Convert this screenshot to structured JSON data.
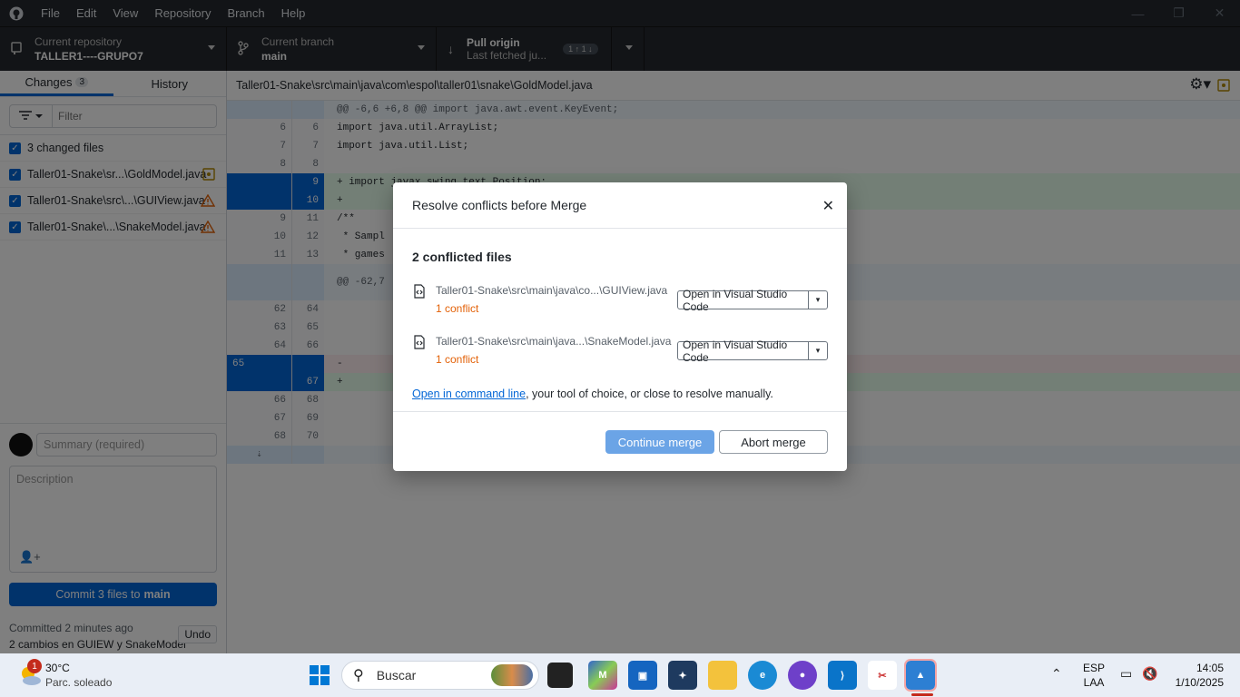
{
  "menubar": {
    "items": [
      "File",
      "Edit",
      "View",
      "Repository",
      "Branch",
      "Help"
    ]
  },
  "toolbar": {
    "repo_title": "Current repository",
    "repo_name": "TALLER1----GRUPO7",
    "branch_title": "Current branch",
    "branch_name": "main",
    "pull_title": "Pull origin",
    "pull_sub": "Last fetched ju...",
    "pull_badge": "1 ↑ 1 ↓"
  },
  "sidebar": {
    "tab_changes": "Changes",
    "tab_changes_count": "3",
    "tab_history": "History",
    "filter_placeholder": "Filter",
    "changed_files": "3 changed files",
    "files": [
      {
        "name": "Taller01-Snake\\sr...\\GoldModel.java",
        "status": "modified"
      },
      {
        "name": "Taller01-Snake\\src\\...\\GUIView.java",
        "status": "conflict"
      },
      {
        "name": "Taller01-Snake\\...\\SnakeModel.java",
        "status": "conflict"
      }
    ],
    "summary_placeholder": "Summary (required)",
    "description_placeholder": "Description",
    "commit_label": "Commit 3 files to",
    "commit_branch": "main",
    "last_commit": "Committed 2 minutes ago",
    "last_commit_msg": "2 cambios en GUIEW y SnakeModel",
    "undo": "Undo"
  },
  "diff": {
    "path": "Taller01-Snake\\src\\main\\java\\com\\espol\\taller01\\snake\\GoldModel.java",
    "lines": [
      {
        "kind": "hunk",
        "old": "",
        "new": "",
        "text": "@@ -6,6 +6,8 @@ import java.awt.event.KeyEvent;"
      },
      {
        "kind": "ctx",
        "old": "6",
        "new": "6",
        "text": "import java.util.ArrayList;"
      },
      {
        "kind": "ctx",
        "old": "7",
        "new": "7",
        "text": "import java.util.List;"
      },
      {
        "kind": "ctx",
        "old": "8",
        "new": "8",
        "text": ""
      },
      {
        "kind": "add",
        "old": "",
        "new": "9",
        "text": "+ import javax.swing.text.Position;"
      },
      {
        "kind": "add",
        "old": "",
        "new": "10",
        "text": "+"
      },
      {
        "kind": "ctx",
        "old": "9",
        "new": "11",
        "text": "/**"
      },
      {
        "kind": "ctx",
        "old": "10",
        "new": "12",
        "text": " * Sampl"
      },
      {
        "kind": "ctx",
        "old": "11",
        "new": "13",
        "text": " * games"
      },
      {
        "kind": "hunk",
        "old": "",
        "new": "",
        "text": "@@ -62,7"
      },
      {
        "kind": "ctx",
        "old": "62",
        "new": "64",
        "text": ""
      },
      {
        "kind": "ctx",
        "old": "63",
        "new": "65",
        "text": ""
      },
      {
        "kind": "ctx",
        "old": "64",
        "new": "66",
        "text": ""
      },
      {
        "kind": "del",
        "old": "65",
        "new": "",
        "text": "-"
      },
      {
        "kind": "add",
        "old": "",
        "new": "67",
        "text": "+"
      },
      {
        "kind": "ctx",
        "old": "66",
        "new": "68",
        "text": ""
      },
      {
        "kind": "ctx",
        "old": "67",
        "new": "69",
        "text": ""
      },
      {
        "kind": "ctx",
        "old": "68",
        "new": "70",
        "text": ""
      }
    ]
  },
  "dialog": {
    "title": "Resolve conflicts before Merge",
    "heading": "2 conflicted files",
    "files": [
      {
        "name": "Taller01-Snake\\src\\main\\java\\co...\\GUIView.java",
        "conflicts": "1 conflict",
        "action": "Open in Visual Studio Code"
      },
      {
        "name": "Taller01-Snake\\src\\main\\java...\\SnakeModel.java",
        "conflicts": "1 conflict",
        "action": "Open in Visual Studio Code"
      }
    ],
    "cmd_link": "Open in command line",
    "cmd_rest": ", your tool of choice, or close to resolve manually.",
    "continue": "Continue merge",
    "abort": "Abort merge"
  },
  "taskbar": {
    "temp": "30°C",
    "weather": "Parc. soleado",
    "weather_badge": "1",
    "search": "Buscar",
    "lang1": "ESP",
    "lang2": "LAA",
    "time": "14:05",
    "date": "1/10/2025"
  }
}
